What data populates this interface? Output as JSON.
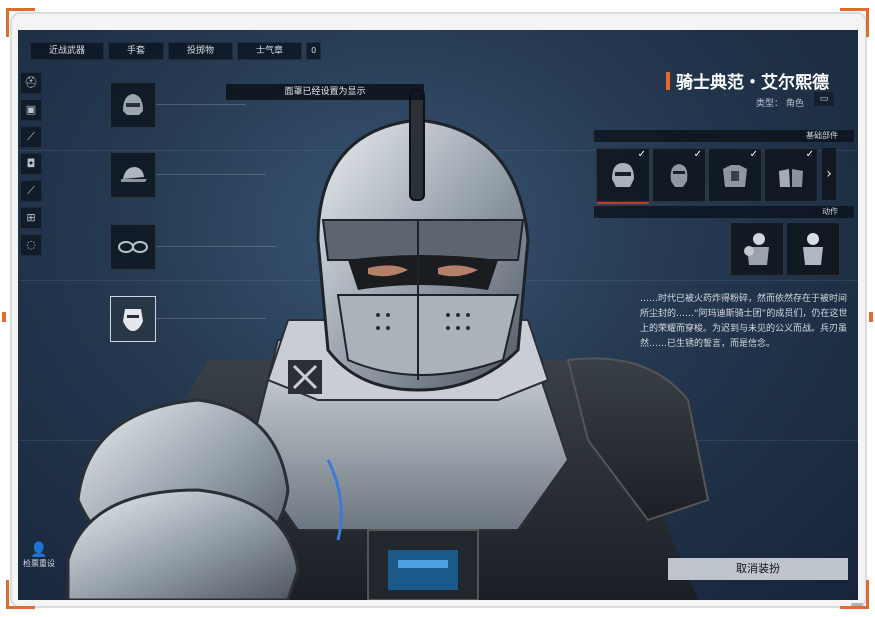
{
  "tabs": [
    "近战武器",
    "手套",
    "投掷物",
    "士气章",
    "0"
  ],
  "notice": "面罩已经设置为显示",
  "character": {
    "name": "骑士典范・艾尔熙德",
    "type_label": "类型：",
    "type_value": "角色"
  },
  "sections": {
    "parts": "基础部件",
    "actions": "动作"
  },
  "description": "……时代已被火药炸得粉碎，然而依然存在于被时间所尘封的……“阿玛迪斯骑士团”的成员们，仍在这世上的荣耀而穿梭。为迟到与未见的公义而战。兵刃虽然……已生锈的誓言，而是信念。",
  "bottom_left_label": "检票重设",
  "cancel_button": "取消装扮",
  "rail_icons": [
    "helmet-icon",
    "vest-icon",
    "knife-icon",
    "backpack-icon",
    "knife-icon",
    "plus-box-icon",
    "circle-icon"
  ],
  "slots": [
    "helmet-icon",
    "cap-icon",
    "glasses-icon",
    "mask-icon"
  ],
  "colors": {
    "accent": "#e26a2c",
    "selection": "#c03a2c"
  }
}
